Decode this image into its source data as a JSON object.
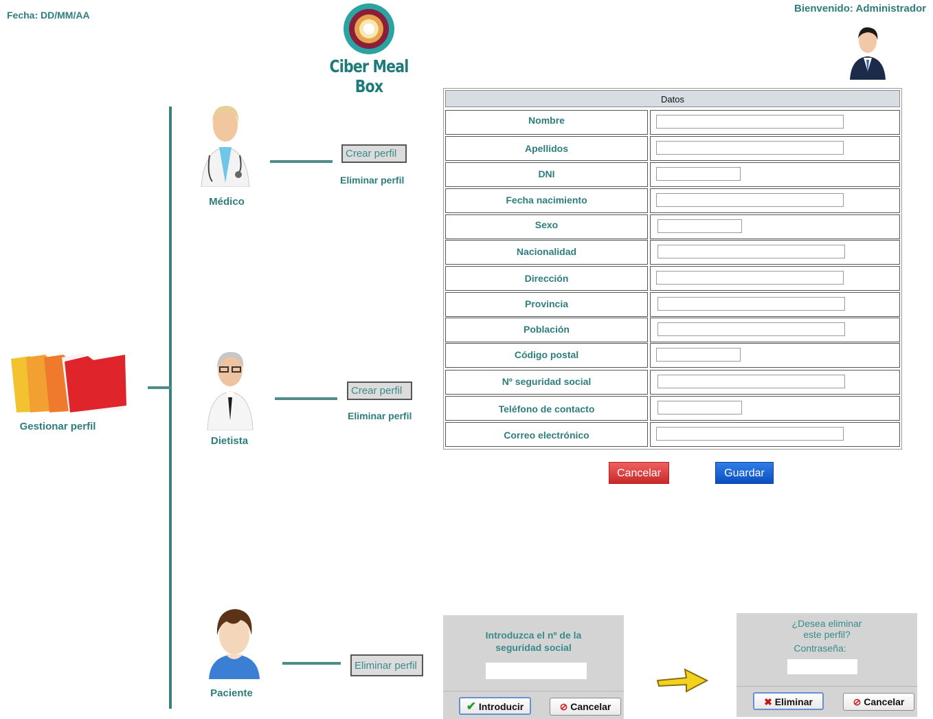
{
  "header": {
    "fecha": "Fecha: DD/MM/AA",
    "welcome": "Bienvenido: Administrador",
    "logo_text": "Ciber Meal Box"
  },
  "root": {
    "label": "Gestionar perfil"
  },
  "profiles": {
    "medico": {
      "label": "Médico",
      "create": "Crear perfil",
      "delete": "Eliminar perfil"
    },
    "dietista": {
      "label": "Dietista",
      "create": "Crear perfil",
      "delete": "Eliminar perfil"
    },
    "paciente": {
      "label": "Paciente",
      "delete": "Eliminar perfil"
    }
  },
  "form": {
    "header": "Datos",
    "fields": [
      "Nombre",
      "Apellidos",
      "DNI",
      "Fecha nacimiento",
      "Sexo",
      "Nacionalidad",
      "Dirección",
      "Provincia",
      "Población",
      "Código postal",
      "Nº seguridad social",
      "Teléfono de contacto",
      "Correo electrónico"
    ],
    "cancel": "Cancelar",
    "save": "Guardar"
  },
  "dialog_ss": {
    "text1": "Introduzca el nº de la",
    "text2": "seguridad social",
    "ok": "Introducir",
    "cancel": "Cancelar"
  },
  "dialog_delete": {
    "text1": "¿Desea eliminar",
    "text2": "este perfil?",
    "password_label": "Contraseña:",
    "ok": "Eliminar",
    "cancel": "Cancelar"
  },
  "colors": {
    "accent": "#2e7d7d",
    "cancel": "#d63a3a",
    "save": "#0d5bd1"
  }
}
